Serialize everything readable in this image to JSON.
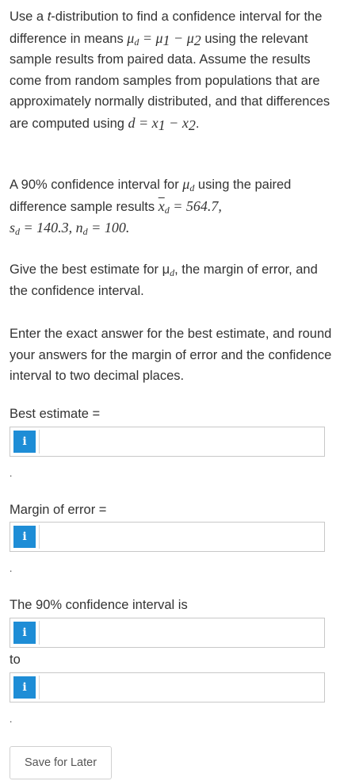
{
  "intro": {
    "t1": "Use a ",
    "t_italic": "t",
    "t2": "-distribution to find a confidence interval for the difference in means ",
    "t3": " using the relevant sample results from paired data. Assume the results come from random samples from populations that are approximately normally distributed, and that differences are computed using ",
    "t4": "."
  },
  "ci": {
    "t1": "A 90% confidence interval for ",
    "t2": " using the paired difference sample results ",
    "xbar_value": "564.7",
    "sd_value": "140.3",
    "nd_value": "100"
  },
  "question": "Give the best estimate for μ",
  "question_tail": ", the margin of error, and the confidence interval.",
  "instructions": "Enter the exact answer for the best estimate, and round your answers for the margin of error and the confidence interval to two decimal places.",
  "fields": {
    "best_estimate_label": "Best estimate =",
    "margin_label": "Margin of error =",
    "interval_label": "The 90% confidence interval is",
    "to_label": "to",
    "info_glyph": "i",
    "trailing_dot": "."
  },
  "save_label": "Save for Later",
  "colors": {
    "info_bg": "#1e8dd6",
    "text": "#333333",
    "border": "#c8c8c8"
  }
}
